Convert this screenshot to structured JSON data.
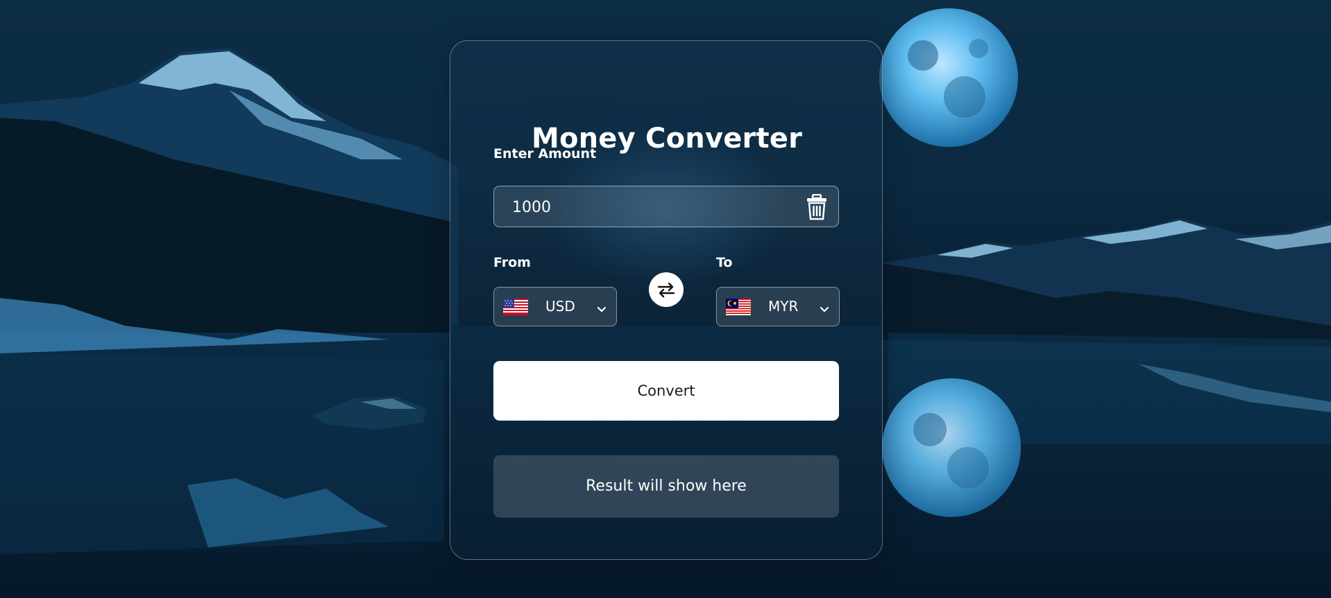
{
  "app": {
    "title": "Money Converter"
  },
  "amount": {
    "label": "Enter Amount",
    "value": "1000",
    "clear_icon": "trash-icon"
  },
  "from": {
    "label": "From",
    "currency": "USD",
    "flag_icon": "us-flag-icon"
  },
  "to": {
    "label": "To",
    "currency": "MYR",
    "flag_icon": "malaysia-flag-icon"
  },
  "swap": {
    "icon": "swap-arrows-icon"
  },
  "convert_button": {
    "label": "Convert"
  },
  "result": {
    "text": "Result will show here"
  },
  "colors": {
    "accent": "#ffffff",
    "background": "#0b2a42",
    "moon": "#4fb3ea"
  }
}
